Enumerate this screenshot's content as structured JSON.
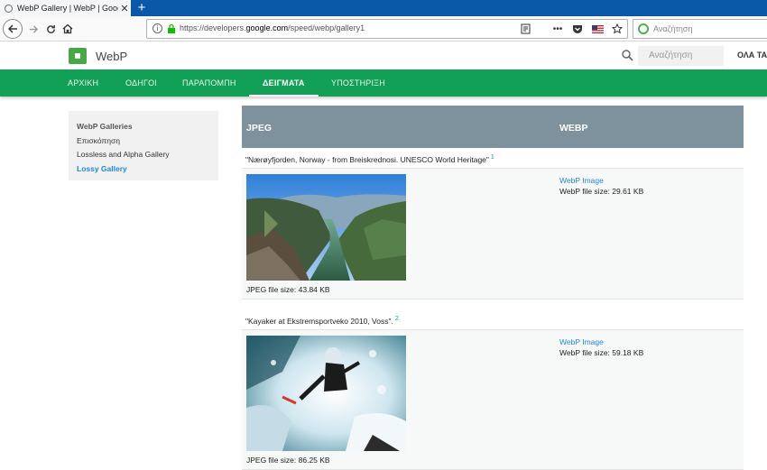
{
  "browser": {
    "tab_title": "WebP Gallery | WebP | Google",
    "tab_close": "✕",
    "new_tab": "+",
    "url_prefix": "https://developers.",
    "url_domain": "google.com",
    "url_suffix": "/speed/webp/gallery1",
    "search_placeholder": "Αναζήτηση"
  },
  "site": {
    "title": "WebP",
    "search_placeholder": "Αναζήτηση",
    "all_link": "ΟΛΑ ΤΑ"
  },
  "nav": {
    "tabs": [
      "ΑΡΧΙΚΗ",
      "ΟΔΗΓΟΙ",
      "ΠΑΡΑΠΟΜΠΗ",
      "ΔΕΙΓΜΑΤΑ",
      "ΥΠΟΣΤΗΡΙΞΗ"
    ],
    "active": "ΔΕΙΓΜΑΤΑ"
  },
  "sidebar": {
    "items": [
      "WebP Galleries",
      "Επισκόπηση",
      "Lossless and Alpha Gallery",
      "Lossy Gallery"
    ]
  },
  "gallery": {
    "header_jpeg": "JPEG",
    "header_webp": "WEBP",
    "rows": [
      {
        "caption": "\"Nærøyfjorden, Norway - from Breiskrednosi. UNESCO World Heritage\"",
        "ref": "1",
        "jpeg_size": "JPEG file size: 43.84 KB",
        "webp_link": "WebP Image",
        "webp_size": "WebP file size: 29.61 KB"
      },
      {
        "caption": "\"Kayaker at Ekstremsportveko 2010, Voss\".",
        "ref": "2",
        "jpeg_size": "JPEG file size: 86.25 KB",
        "webp_link": "WebP Image",
        "webp_size": "WebP file size: 59.18 KB"
      }
    ]
  },
  "colors": {
    "tab_strip": "#0a58a8",
    "green_nav": "#11a055",
    "table_header": "#7e929d",
    "link": "#2387d9"
  },
  "icons": [
    "back-icon",
    "forward-icon",
    "reload-icon",
    "home-icon",
    "info-icon",
    "lock-icon",
    "reader-icon",
    "more-icon",
    "pocket-icon",
    "flag-icon",
    "bookmark-star-icon",
    "search-icon"
  ]
}
